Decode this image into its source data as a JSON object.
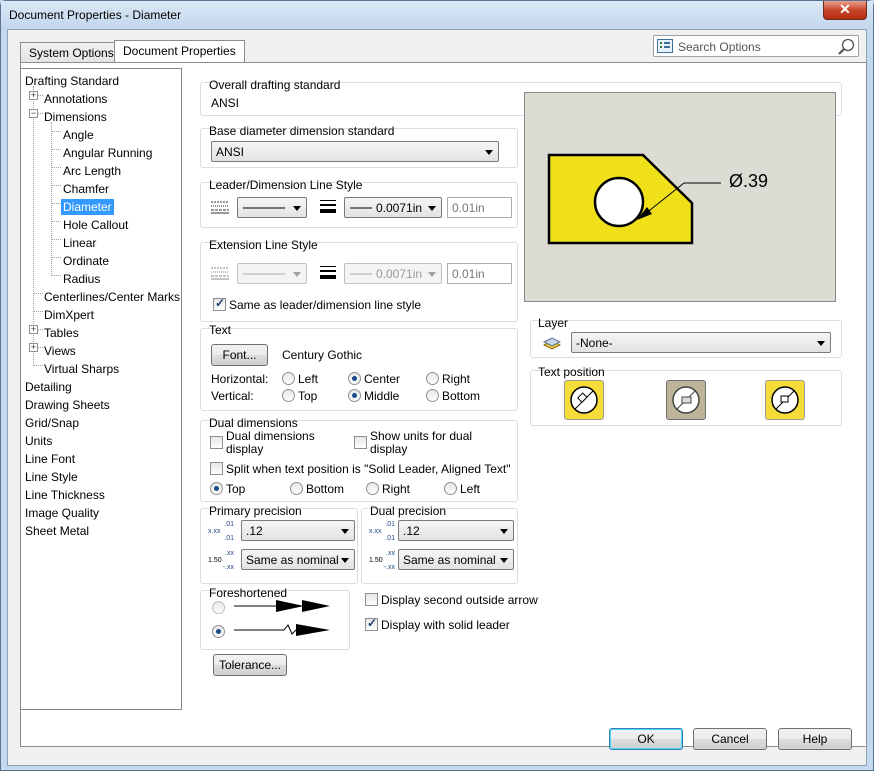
{
  "window": {
    "title": "Document Properties - Diameter"
  },
  "tabs": [
    "System Options",
    "Document Properties"
  ],
  "search": {
    "placeholder": "Search Options"
  },
  "tree": [
    {
      "label": "Drafting Standard"
    },
    {
      "label": "Annotations"
    },
    {
      "label": "Dimensions"
    },
    {
      "label": "Angle"
    },
    {
      "label": "Angular Running"
    },
    {
      "label": "Arc Length"
    },
    {
      "label": "Chamfer"
    },
    {
      "label": "Diameter"
    },
    {
      "label": "Hole Callout"
    },
    {
      "label": "Linear"
    },
    {
      "label": "Ordinate"
    },
    {
      "label": "Radius"
    },
    {
      "label": "Centerlines/Center Marks"
    },
    {
      "label": "DimXpert"
    },
    {
      "label": "Tables"
    },
    {
      "label": "Views"
    },
    {
      "label": "Virtual Sharps"
    },
    {
      "label": "Detailing"
    },
    {
      "label": "Drawing Sheets"
    },
    {
      "label": "Grid/Snap"
    },
    {
      "label": "Units"
    },
    {
      "label": "Line Font"
    },
    {
      "label": "Line Style"
    },
    {
      "label": "Line Thickness"
    },
    {
      "label": "Image Quality"
    },
    {
      "label": "Sheet Metal"
    }
  ],
  "overall": {
    "label": "Overall drafting standard",
    "value": "ANSI"
  },
  "base": {
    "label": "Base diameter dimension standard",
    "value": "ANSI"
  },
  "leader": {
    "label": "Leader/Dimension Line Style",
    "thickness": "0.0071in",
    "custom": "0.01in"
  },
  "extension": {
    "label": "Extension Line Style",
    "thickness": "0.0071in",
    "custom": "0.01in",
    "same_label": "Same as leader/dimension line style"
  },
  "text": {
    "label": "Text",
    "font_button": "Font...",
    "font_name": "Century Gothic",
    "horizontal": "Horizontal:",
    "vertical": "Vertical:",
    "left": "Left",
    "center": "Center",
    "right": "Right",
    "top": "Top",
    "middle": "Middle",
    "bottom": "Bottom"
  },
  "dual": {
    "label": "Dual dimensions",
    "display_1": "Dual dimensions",
    "display_2": "display",
    "units_1": "Show units for dual",
    "units_2": "display",
    "split": "Split when text position is \"Solid Leader, Aligned Text\"",
    "top": "Top",
    "bottom": "Bottom",
    "right": "Right",
    "left": "Left"
  },
  "primary": {
    "label": "Primary precision",
    "value": ".12",
    "tolerance": "Same as nominal"
  },
  "dualprec": {
    "label": "Dual precision",
    "value": ".12",
    "tolerance": "Same as nominal"
  },
  "prec_icons": {
    "a1": ".01",
    "a2": "x.xx",
    "a3": ".01",
    "b1": "1.50",
    "b2": ".xx",
    "b3": "-.xx"
  },
  "foreshortened": {
    "label": "Foreshortened"
  },
  "arrows": {
    "second": "Display second outside arrow",
    "solid": "Display with solid leader"
  },
  "tolerance_button": "Tolerance...",
  "preview": {
    "dim_text": "Ø.39",
    "colors": {
      "part": "#f0e01a",
      "bg": "#dcdcd4"
    }
  },
  "layer": {
    "label": "Layer",
    "value": "-None-"
  },
  "textpos": {
    "label": "Text position"
  },
  "footer": {
    "ok": "OK",
    "cancel": "Cancel",
    "help": "Help"
  }
}
